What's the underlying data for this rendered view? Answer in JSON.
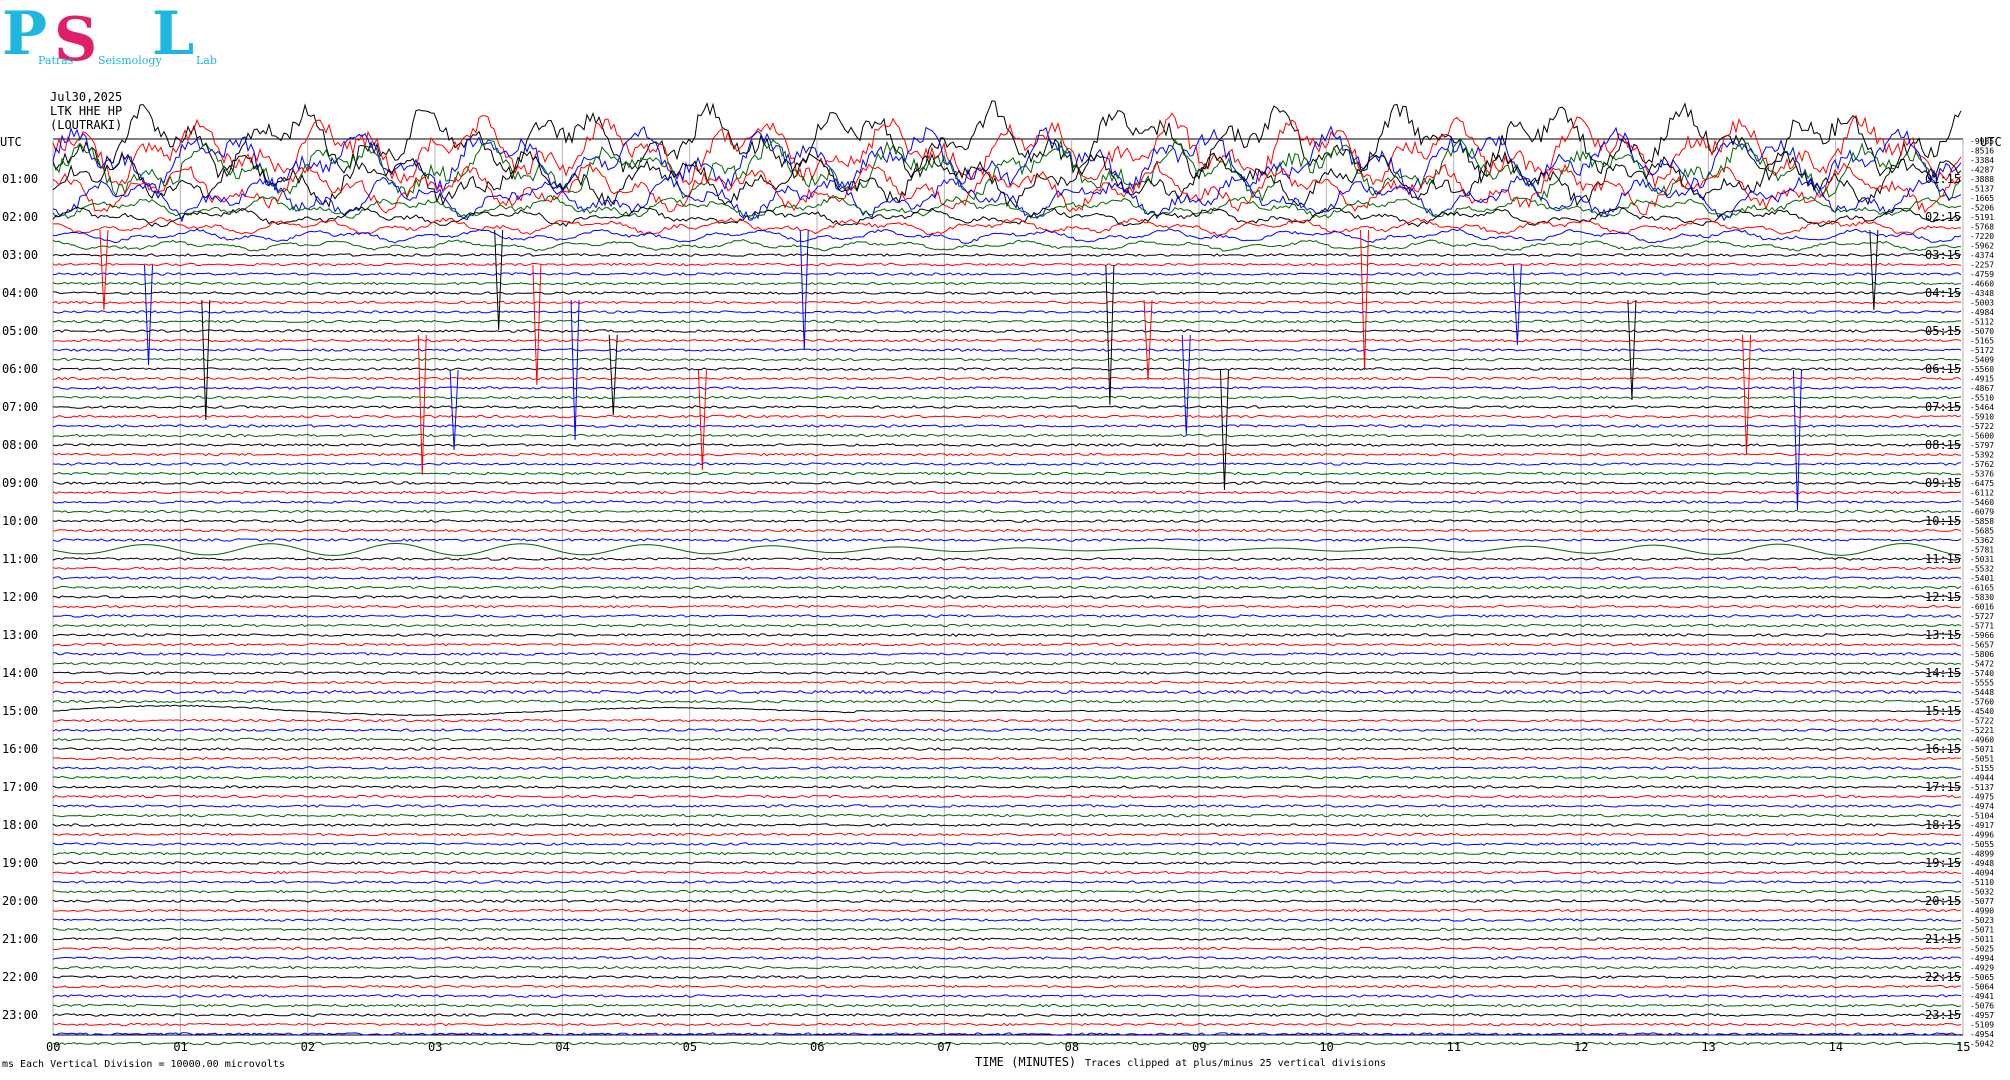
{
  "logo": {
    "big_p": "P",
    "big_s": "S",
    "big_l": "L",
    "small_1": "Patras",
    "small_2": "Seismology",
    "small_3": "Lab"
  },
  "header": {
    "date": "Jul30,2025",
    "station": "LTK HHE HP",
    "location": "(LOUTRAKI)",
    "utc_left": "UTC",
    "utc_right": "UTC"
  },
  "footer": {
    "corner": "ms",
    "division": "Each Vertical Division = 10000.00 microvolts",
    "xlabel": "TIME (MINUTES)",
    "clip_note": "Traces clipped at plus/minus 25 vertical divisions"
  },
  "colors": {
    "black": "#000000",
    "red": "#ff0000",
    "blue": "#0000ff",
    "green": "#006400",
    "grid": "#b0b0b0"
  },
  "chart_data": {
    "type": "line",
    "title": "",
    "xlabel": "TIME (MINUTES)",
    "xlim": [
      0,
      15
    ],
    "x_ticks": [
      "00",
      "01",
      "02",
      "03",
      "04",
      "05",
      "06",
      "07",
      "08",
      "09",
      "10",
      "11",
      "12",
      "13",
      "14",
      "15"
    ],
    "left_hour_labels": [
      "01:00",
      "02:00",
      "03:00",
      "04:00",
      "05:00",
      "06:00",
      "07:00",
      "08:00",
      "09:00",
      "10:00",
      "11:00",
      "12:00",
      "13:00",
      "14:00",
      "15:00",
      "16:00",
      "17:00",
      "18:00",
      "19:00",
      "20:00",
      "21:00",
      "22:00",
      "23:00"
    ],
    "right_hour_labels": [
      "01:15",
      "02:15",
      "03:15",
      "04:15",
      "05:15",
      "06:15",
      "07:15",
      "08:15",
      "09:15",
      "10:15",
      "11:15",
      "12:15",
      "13:15",
      "14:15",
      "15:15",
      "16:15",
      "17:15",
      "18:15",
      "19:15",
      "20:15",
      "21:15",
      "22:15",
      "23:15"
    ],
    "trace_color_cycle": [
      "black",
      "red",
      "blue",
      "green"
    ],
    "trace_offsets": [
      -9985,
      -8516,
      -3384,
      -4287,
      -3888,
      -5137,
      -1665,
      -5206,
      -5191,
      -5768,
      -7220,
      -5962,
      -4374,
      -2257,
      -4759,
      -4660,
      -4348,
      -5003,
      -4984,
      -5112,
      -5070,
      -5165,
      -5172,
      -5409,
      -5560,
      -4915,
      -4867,
      -5510,
      -5464,
      -5910,
      -5722,
      -5600,
      -5797,
      -5392,
      -5762,
      -5376,
      -6475,
      -6112,
      -5460,
      -6079,
      -5858,
      -5685,
      -5362,
      -5781,
      -5031,
      -5532,
      -5401,
      -6165,
      -5830,
      -6016,
      -5727,
      -5771,
      -5966,
      -5657,
      -5806,
      -5472,
      -5740,
      -5555,
      -5448,
      -5760,
      -4540,
      -5722,
      -5221,
      -4960,
      -5071,
      -5051,
      -5155,
      -4944,
      -5137,
      -4975,
      -4974,
      -5104,
      -4917,
      -4996,
      -5055,
      -4899,
      -4948,
      -4094,
      -5110,
      -5032,
      -5077,
      -4990,
      -5023,
      -5071,
      -5011,
      -5025,
      -4994,
      -4929,
      -5065,
      -5064,
      -4941,
      -5076,
      -4957,
      -5109,
      -4954,
      -5042
    ]
  }
}
